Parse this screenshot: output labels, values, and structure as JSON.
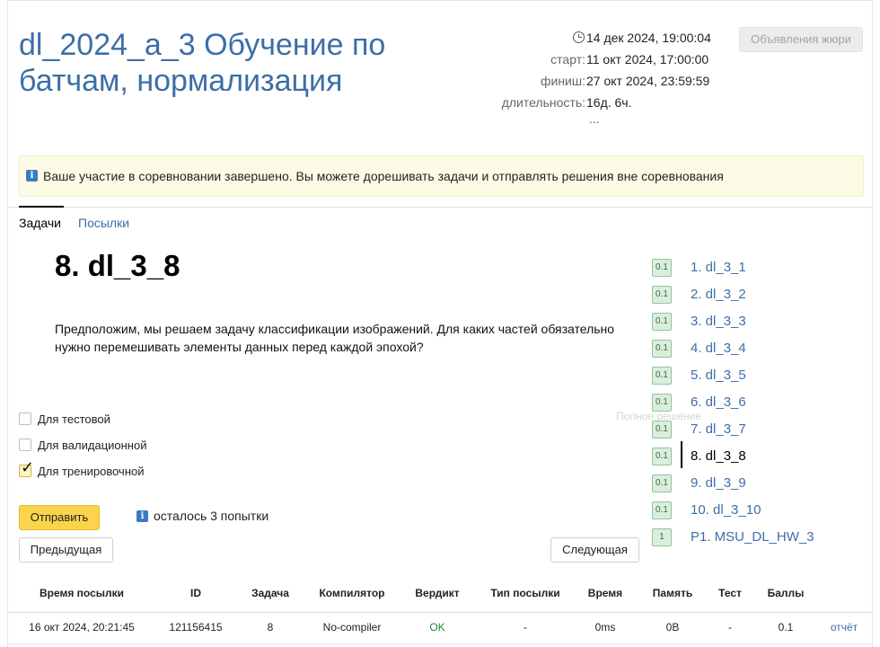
{
  "contest": {
    "title": "dl_2024_a_3 Обучение по батчам, нормализация",
    "current_time": "14 дек 2024, 19:00:04",
    "start_label": "старт:",
    "start": "11 окт 2024, 17:00:00",
    "finish_label": "финиш:",
    "finish": "27 окт 2024, 23:59:59",
    "duration_label": "длительность:",
    "duration": "16д. 6ч.",
    "more": "...",
    "jury_announcements_label": "Объявления жюри"
  },
  "notice": {
    "icon": "info-icon",
    "text": "Ваше участие в соревновании завершено. Вы можете дорешивать задачи и отправлять решения вне соревнования"
  },
  "tabs": [
    {
      "label": "Задачи",
      "active": true
    },
    {
      "label": "Посылки",
      "active": false
    }
  ],
  "problem": {
    "title": "8. dl_3_8",
    "statement": "Предположим, мы решаем задачу классификации изображений. Для каких частей обязательно нужно перемешивать элементы данных перед каждой эпохой?",
    "options": [
      {
        "label": "Для тестовой",
        "checked": false
      },
      {
        "label": "Для валидационной",
        "checked": false
      },
      {
        "label": "Для тренировочной",
        "checked": true
      }
    ],
    "hint": "Полное решение",
    "submit_label": "Отправить",
    "attempts_left": "осталось 3 попытки",
    "prev_label": "Предыдущая",
    "next_label": "Следующая"
  },
  "problem_list": [
    {
      "score": "0.1",
      "label": "1. dl_3_1",
      "current": false
    },
    {
      "score": "0.1",
      "label": "2. dl_3_2",
      "current": false
    },
    {
      "score": "0.1",
      "label": "3. dl_3_3",
      "current": false
    },
    {
      "score": "0.1",
      "label": "4. dl_3_4",
      "current": false
    },
    {
      "score": "0.1",
      "label": "5. dl_3_5",
      "current": false
    },
    {
      "score": "0.1",
      "label": "6. dl_3_6",
      "current": false
    },
    {
      "score": "0.1",
      "label": "7. dl_3_7",
      "current": false
    },
    {
      "score": "0.1",
      "label": "8. dl_3_8",
      "current": true
    },
    {
      "score": "0.1",
      "label": "9. dl_3_9",
      "current": false
    },
    {
      "score": "0.1",
      "label": "10. dl_3_10",
      "current": false
    },
    {
      "score": "1",
      "label": "P1. MSU_DL_HW_3",
      "current": false
    }
  ],
  "submissions": {
    "headers": [
      "Время посылки",
      "ID",
      "Задача",
      "Компилятор",
      "Вердикт",
      "Тип посылки",
      "Время",
      "Память",
      "Тест",
      "Баллы"
    ],
    "rows": [
      {
        "time": "16 окт 2024, 20:21:45",
        "id": "121156415",
        "problem": "8",
        "compiler": "No-compiler",
        "verdict": "OK",
        "type": "-",
        "run_time": "0ms",
        "memory": "0B",
        "test": "-",
        "score": "0.1",
        "report": "отчёт"
      }
    ]
  },
  "colors": {
    "link": "#3d6ea8",
    "submit": "#fbd44c",
    "notice_bg": "#fdfbe6",
    "ok": "#2a8b2a"
  }
}
